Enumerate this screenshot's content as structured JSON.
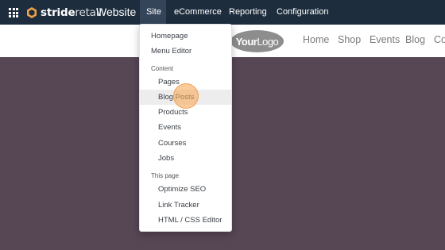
{
  "topbar": {
    "brand_bold": "stride",
    "brand_light": "retail",
    "app_name": "Website",
    "menu": [
      "Site",
      "eCommerce",
      "Reporting",
      "Configuration"
    ]
  },
  "site": {
    "logo_bold": "Your",
    "logo_light": "Logo",
    "nav": [
      "Home",
      "Shop",
      "Events",
      "Blog",
      "Co"
    ]
  },
  "dropdown": {
    "top_items": [
      "Homepage",
      "Menu Editor"
    ],
    "content_header": "Content",
    "content_items": [
      "Pages",
      "Blog Posts",
      "Products",
      "Events",
      "Courses",
      "Jobs"
    ],
    "this_page_header": "This page",
    "this_page_items": [
      "Optimize SEO",
      "Link Tracker",
      "HTML / CSS Editor"
    ]
  },
  "colors": {
    "navbar": "#1d2d3d",
    "active_menu": "#34455a",
    "hero": "#574654",
    "cursor": "#f7aa5a"
  }
}
